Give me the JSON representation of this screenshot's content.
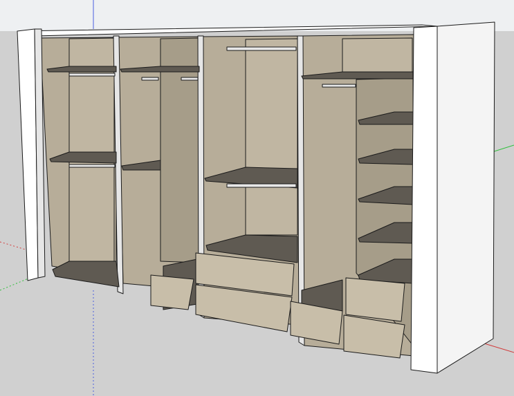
{
  "viewport": {
    "colors": {
      "sky": "#eef0f2",
      "ground": "#d0d0d0",
      "panel_white": "#ffffff",
      "panel_shade": "#e6e6e6",
      "back_wall": "#b7ad99",
      "inner_wall": "#a69d89",
      "shelf": "#5f5a52",
      "drawer_front": "#c8bea9",
      "drawer_top": "#8f8775",
      "rail": "#e8e8e8",
      "edge": "#1a1a1a",
      "axis_blue": "#4a5ee0",
      "axis_green": "#2fbf3a",
      "axis_red": "#d23a3a"
    }
  }
}
